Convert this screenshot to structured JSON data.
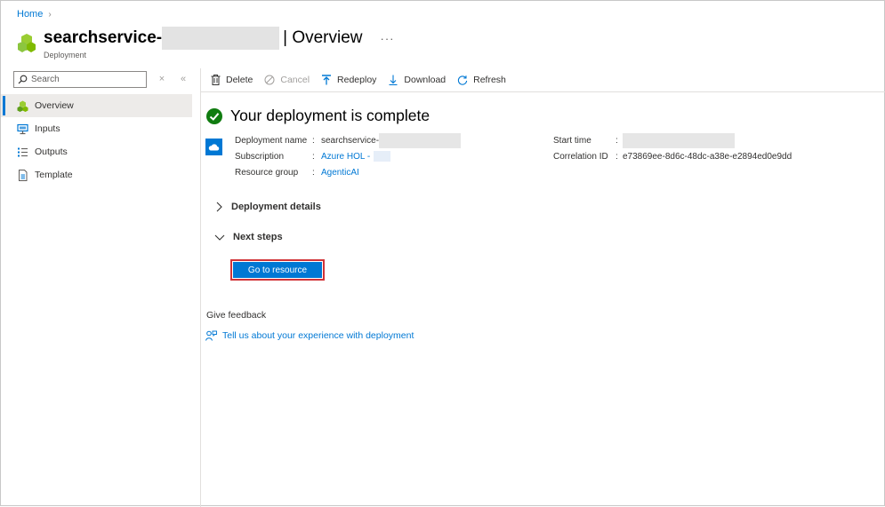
{
  "breadcrumb": {
    "home": "Home"
  },
  "header": {
    "name": "searchservice-",
    "separator": "| Overview",
    "more": "···",
    "subtitle": "Deployment"
  },
  "sidebar": {
    "search_placeholder": "Search",
    "items": [
      {
        "label": "Overview",
        "icon": "overview-icon"
      },
      {
        "label": "Inputs",
        "icon": "inputs-icon"
      },
      {
        "label": "Outputs",
        "icon": "outputs-icon"
      },
      {
        "label": "Template",
        "icon": "template-icon"
      }
    ]
  },
  "toolbar": {
    "delete": "Delete",
    "cancel": "Cancel",
    "redeploy": "Redeploy",
    "download": "Download",
    "refresh": "Refresh"
  },
  "status": {
    "text": "Your deployment is complete"
  },
  "details": {
    "deployment_name_label": "Deployment name",
    "deployment_name_value": "searchservice-",
    "subscription_label": "Subscription",
    "subscription_value": "Azure HOL -",
    "resource_group_label": "Resource group",
    "resource_group_value": "AgenticAI",
    "start_time_label": "Start time",
    "correlation_label": "Correlation ID",
    "correlation_value": "e73869ee-8d6c-48dc-a38e-e2894ed0e9dd"
  },
  "sections": {
    "deployment_details": "Deployment details",
    "next_steps": "Next steps"
  },
  "actions": {
    "go_to_resource": "Go to resource"
  },
  "feedback": {
    "label": "Give feedback",
    "link": "Tell us about your experience with deployment"
  },
  "colors": {
    "accent": "#0078d4",
    "highlight_border": "#d13438",
    "success": "#107c10",
    "resource_green": "#7fba00"
  }
}
